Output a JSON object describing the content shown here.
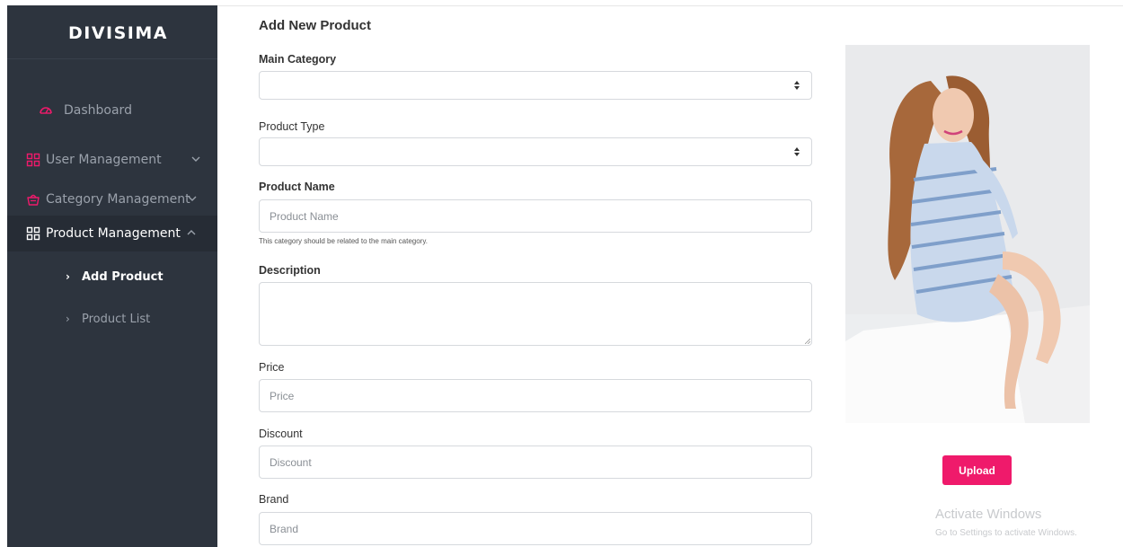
{
  "sidebar": {
    "brand": "DIVISIMA",
    "items": [
      {
        "label": "Dashboard",
        "icon": "dashboard-icon"
      },
      {
        "label": "User Management",
        "icon": "grid-icon"
      },
      {
        "label": "Category Management",
        "icon": "basket-icon"
      },
      {
        "label": "Product Management",
        "icon": "grid-icon"
      }
    ],
    "product_submenu": [
      {
        "label": "Add Product",
        "active": true
      },
      {
        "label": "Product List",
        "active": false
      }
    ],
    "accent_color": "#ef1a6b"
  },
  "form": {
    "title": "Add New Product",
    "main_category": {
      "label": "Main Category",
      "value": ""
    },
    "product_type": {
      "label": "Product Type",
      "value": ""
    },
    "product_name": {
      "label": "Product Name",
      "placeholder": "Product Name",
      "value": ""
    },
    "help_text": "This category should be related to the main category.",
    "description": {
      "label": "Description",
      "value": ""
    },
    "price": {
      "label": "Price",
      "placeholder": "Price",
      "value": ""
    },
    "discount": {
      "label": "Discount",
      "placeholder": "Discount",
      "value": ""
    },
    "brand": {
      "label": "Brand",
      "placeholder": "Brand",
      "value": ""
    }
  },
  "image_panel": {
    "upload_label": "Upload",
    "upload_color": "#ef1a6b"
  },
  "watermark": {
    "line1": "Activate Windows",
    "line2": "Go to Settings to activate Windows."
  }
}
